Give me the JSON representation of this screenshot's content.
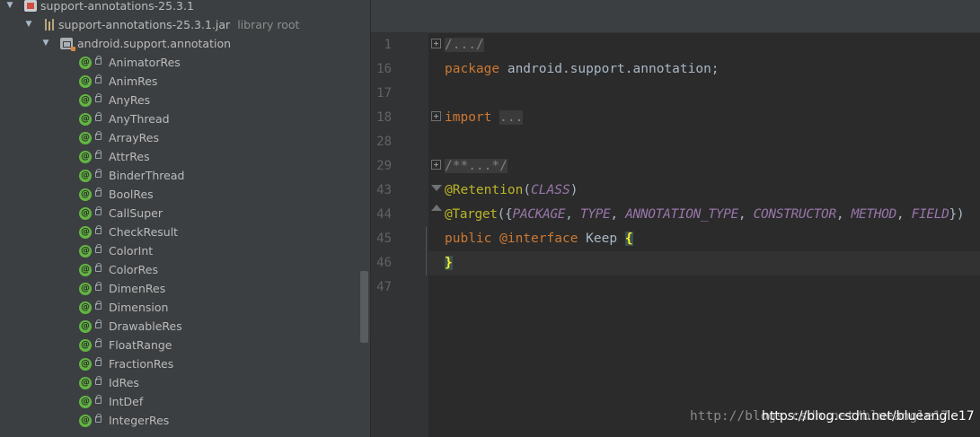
{
  "tree": {
    "module": {
      "label": "support-annotations-25.3.1"
    },
    "jar": {
      "label": "support-annotations-25.3.1.jar",
      "note": "library root"
    },
    "package": {
      "label": "android.support.annotation"
    },
    "items": [
      {
        "label": "AnimatorRes"
      },
      {
        "label": "AnimRes"
      },
      {
        "label": "AnyRes"
      },
      {
        "label": "AnyThread"
      },
      {
        "label": "ArrayRes"
      },
      {
        "label": "AttrRes"
      },
      {
        "label": "BinderThread"
      },
      {
        "label": "BoolRes"
      },
      {
        "label": "CallSuper"
      },
      {
        "label": "CheckResult"
      },
      {
        "label": "ColorInt"
      },
      {
        "label": "ColorRes"
      },
      {
        "label": "DimenRes"
      },
      {
        "label": "Dimension"
      },
      {
        "label": "DrawableRes"
      },
      {
        "label": "FloatRange"
      },
      {
        "label": "FractionRes"
      },
      {
        "label": "IdRes"
      },
      {
        "label": "IntDef"
      },
      {
        "label": "IntegerRes"
      }
    ],
    "annotation_icon_symbol": "@"
  },
  "editor": {
    "line_numbers": [
      "1",
      "16",
      "17",
      "18",
      "28",
      "29",
      "43",
      "44",
      "45",
      "46",
      "47"
    ],
    "lines": {
      "l1": {
        "folded": "/.../"
      },
      "l16": {
        "keyword": "package",
        "rest": " android.support.annotation;"
      },
      "l18": {
        "keyword": "import",
        "space": " ",
        "folded": "..."
      },
      "l29": {
        "folded": "/**...*/"
      },
      "l43": {
        "annotation": "@Retention",
        "open": "(",
        "arg": "CLASS",
        "close": ")"
      },
      "l44": {
        "annotation": "@Target",
        "open": "({",
        "args": [
          {
            "name": "PACKAGE",
            "sep": ", "
          },
          {
            "name": "TYPE",
            "sep": ", "
          },
          {
            "name": "ANNOTATION_TYPE",
            "sep": ", "
          },
          {
            "name": "CONSTRUCTOR",
            "sep": ", "
          },
          {
            "name": "METHOD",
            "sep": ", "
          },
          {
            "name": "FIELD",
            "sep": ""
          }
        ],
        "close": "})"
      },
      "l45": {
        "kw1": "public",
        "kw2": " @interface",
        "name": " Keep ",
        "brace": "{"
      },
      "l46": {
        "brace": "}"
      }
    }
  },
  "watermark": {
    "faint_prefix": "http://b",
    "faint_suffix": "logs.csdn.net/blueangle17",
    "url": "https://blog.csdn.net/blueangle17"
  },
  "colors": {
    "keyword": "#cc7832",
    "annotation": "#bbb529",
    "constant": "#9876aa",
    "comment": "#808080",
    "annotation_icon": "#62b543"
  }
}
